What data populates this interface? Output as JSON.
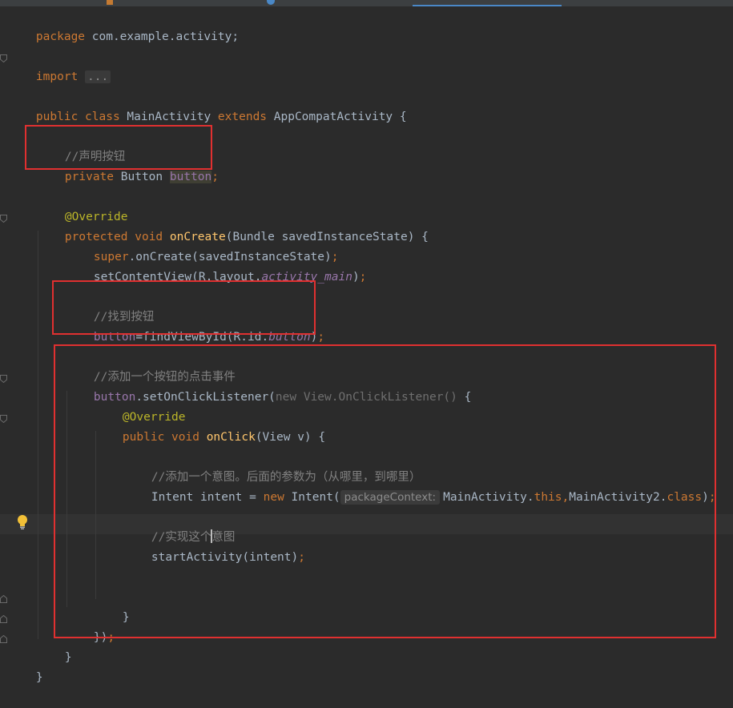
{
  "tabs": {
    "active_tab_accent": "#4a88c7",
    "fragment_colors": [
      "#3c3f41",
      "#c47a32",
      "#4a88c7"
    ]
  },
  "code": {
    "l1": {
      "kw": "package",
      "rest": " com.example.activity;"
    },
    "l3": {
      "kw": "import",
      "ellipsis": "..."
    },
    "l5": {
      "kw1": "public",
      "kw2": "class",
      "name": " MainActivity ",
      "kw3": "extends",
      "rest": " AppCompatActivity {"
    },
    "l7": {
      "comment": "//声明按钮"
    },
    "l8": {
      "kw": "private",
      "type": " Button ",
      "field": "button",
      "semi": ";"
    },
    "l10": {
      "annotation": "@Override"
    },
    "l11": {
      "kw1": "protected",
      "kw2": "void",
      "method": "onCreate",
      "params": "(Bundle savedInstanceState) {"
    },
    "l12": {
      "kw": "super",
      "rest": ".onCreate(savedInstanceState)",
      "semi": ";"
    },
    "l13": {
      "pre": "setContentView(R.layout.",
      "sfield": "activity_main",
      "post": ")",
      "semi": ";"
    },
    "l15": {
      "comment": "//找到按钮"
    },
    "l16": {
      "field": "button",
      "pre": "=findViewById(R.id.",
      "sfield": "button",
      "post": ")",
      "semi": ";"
    },
    "l18": {
      "comment": "//添加一个按钮的点击事件"
    },
    "l19": {
      "field": "button",
      "pre": ".setOnClickListener(",
      "dim": "new View.OnClickListener()",
      "post": " {"
    },
    "l20": {
      "annotation": "@Override"
    },
    "l21": {
      "kw1": "public",
      "kw2": "void",
      "method": "onClick",
      "params": "(View v) {"
    },
    "l23": {
      "comment": "//添加一个意图。后面的参数为（从哪里，到哪里）"
    },
    "l24": {
      "pre": "Intent intent = ",
      "kw": "new",
      "mid": " Intent(",
      "hint": "packageContext:",
      "arg1": "MainActivity.",
      "kw2": "this",
      "comma": ",",
      "arg2": "MainActivity2.",
      "kw3": "class",
      "post": ")",
      "semi": ";"
    },
    "l26": {
      "comment_a": "//实现这个",
      "comment_b": "意图"
    },
    "l27": {
      "pre": "startActivity(intent)",
      "semi": ";"
    },
    "l30": {
      "text": "}"
    },
    "l31": {
      "text": "})",
      "semi": ";"
    },
    "l32": {
      "text": "}"
    },
    "l33": {
      "text": "}"
    }
  },
  "highlight_colors": {
    "box": "#e03030",
    "keyword": "#cc7832",
    "annotation": "#bbb529",
    "method": "#ffc66d",
    "comment": "#808080",
    "field": "#9876aa",
    "text": "#a9b7c6",
    "background": "#2b2b2b"
  },
  "icons": {
    "bulb": "lightbulb-icon",
    "fold": "fold-icon"
  }
}
